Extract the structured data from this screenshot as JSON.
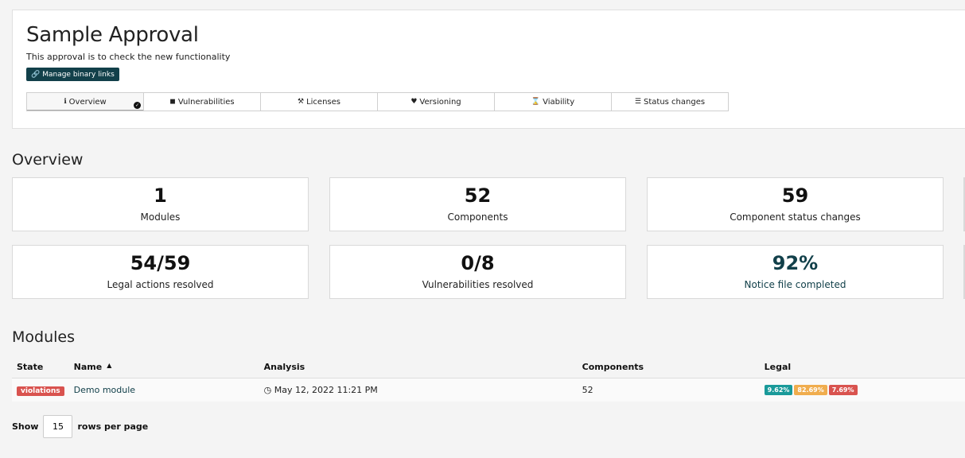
{
  "header": {
    "title": "Sample Approval",
    "description": "This approval is to check the new functionality",
    "manage_button": {
      "icon": "link-icon",
      "label": "Manage binary links"
    }
  },
  "tabs": [
    {
      "label": "Overview",
      "icon": "info-icon",
      "active": true
    },
    {
      "label": "Vulnerabilities",
      "icon": "shield-icon"
    },
    {
      "label": "Licenses",
      "icon": "gavel-icon"
    },
    {
      "label": "Versioning",
      "icon": "heartbeat-icon"
    },
    {
      "label": "Viability",
      "icon": "hourglass-icon"
    },
    {
      "label": "Status changes",
      "icon": "list-icon"
    }
  ],
  "overview": {
    "title": "Overview",
    "stats": [
      {
        "value": "1",
        "label": "Modules"
      },
      {
        "value": "52",
        "label": "Components"
      },
      {
        "value": "59",
        "label": "Component status changes"
      },
      {
        "value": "54/59",
        "label": "Legal actions resolved"
      },
      {
        "value": "0/8",
        "label": "Vulnerabilities resolved"
      },
      {
        "value": "92%",
        "label": "Notice file completed"
      }
    ]
  },
  "modules": {
    "title": "Modules",
    "columns": {
      "state": "State",
      "name": "Name",
      "analysis": "Analysis",
      "components": "Components",
      "legal": "Legal"
    },
    "rows": [
      {
        "state": "violations",
        "name": "Demo module",
        "analysis": "May 12, 2022 11:21 PM",
        "components": "52",
        "legal": [
          "9.62%",
          "82.69%",
          "7.69%"
        ]
      }
    ],
    "colors": {
      "green": "#1a9a9a",
      "orange": "#f0ad4e",
      "red": "#d9534f"
    },
    "pagination": {
      "show_label": "Show",
      "rows_value": "15",
      "suffix": "rows per page"
    }
  }
}
